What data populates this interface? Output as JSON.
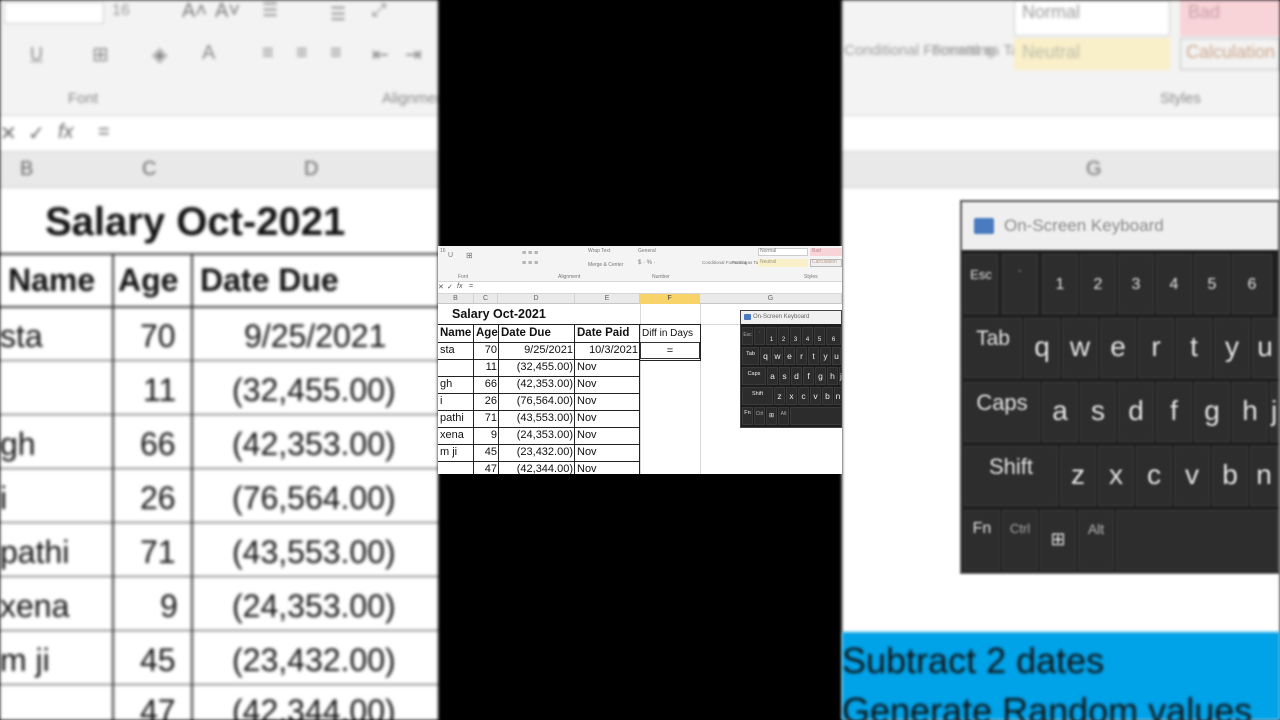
{
  "ribbon": {
    "font_size": "16",
    "font_group": "Font",
    "alignment_group": "Alignment",
    "number_group": "Number",
    "styles_group": "Styles",
    "wrap_text": "Wrap Text",
    "merge_center": "Merge & Center",
    "number_format": "General",
    "conditional": "Conditional Formatting",
    "format_as_table": "Format as Table",
    "style_normal": "Normal",
    "style_bad": "Bad",
    "style_neutral": "Neutral",
    "style_calculation": "Calculation",
    "cancel_symbol": "✕",
    "enter_symbol": "✓",
    "fx": "fx",
    "formula_value": "="
  },
  "columns": [
    "B",
    "C",
    "D",
    "E",
    "F",
    "G"
  ],
  "sheet": {
    "title": "Salary Oct-2021",
    "headers": [
      "Name",
      "Age",
      "Date Due",
      "Date Paid",
      "Diff in Days"
    ],
    "rows": [
      {
        "name": "sta",
        "age": "70",
        "due": "9/25/2021",
        "paid": "10/3/2021",
        "diff": "="
      },
      {
        "name": "",
        "age": "11",
        "due": "(32,455.00)",
        "paid": "Nov",
        "diff": ""
      },
      {
        "name": "gh",
        "age": "66",
        "due": "(42,353.00)",
        "paid": "Nov",
        "diff": ""
      },
      {
        "name": "i",
        "age": "26",
        "due": "(76,564.00)",
        "paid": "Nov",
        "diff": ""
      },
      {
        "name": "pathi",
        "age": "71",
        "due": "(43,553.00)",
        "paid": "Nov",
        "diff": ""
      },
      {
        "name": "xena",
        "age": "9",
        "due": "(24,353.00)",
        "paid": "Nov",
        "diff": ""
      },
      {
        "name": "m ji",
        "age": "45",
        "due": "(23,432.00)",
        "paid": "Nov",
        "diff": ""
      },
      {
        "name": "",
        "age": "47",
        "due": "(42,344.00)",
        "paid": "Nov",
        "diff": ""
      }
    ]
  },
  "keyboard": {
    "title": "On-Screen Keyboard",
    "row0": [
      "Esc",
      "`",
      "1",
      "2",
      "3",
      "4",
      "5",
      "6"
    ],
    "row1": [
      "Tab",
      "q",
      "w",
      "e",
      "r",
      "t",
      "y",
      "u"
    ],
    "row2": [
      "Caps",
      "a",
      "s",
      "d",
      "f",
      "g",
      "h",
      "j"
    ],
    "row3": [
      "Shift",
      "z",
      "x",
      "c",
      "v",
      "b",
      "n"
    ],
    "row4": [
      "Fn",
      "Ctrl",
      "Win",
      "Alt"
    ]
  },
  "notes": {
    "line1": "Subtract 2 dates",
    "line2": "Generate Random values"
  },
  "colors": {
    "accent_blue": "#00a2e8",
    "selected_col": "#f7d36a"
  }
}
